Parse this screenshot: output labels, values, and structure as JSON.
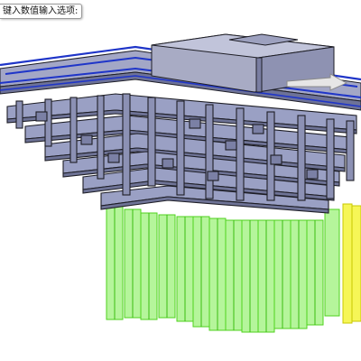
{
  "prompt": {
    "text": "键入数值输入选项:"
  },
  "colors": {
    "background": "#ffffff",
    "deck_outline": "#1f35c8",
    "steel_frame": "#9a9ec0",
    "steel_edge": "#1e1e26",
    "cap_block": "#a8abc4",
    "piles": "#66e83a",
    "highlighted_piles": "#f2f23a",
    "arrow": "#e6e6e6"
  },
  "scene": {
    "deck_layers": 1,
    "truss_levels": 6,
    "pile_groups": [
      "green",
      "yellow"
    ]
  }
}
